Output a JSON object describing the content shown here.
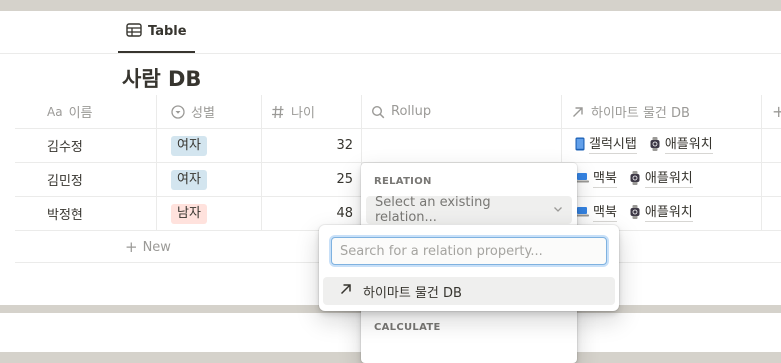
{
  "view_tab": {
    "label": "Table",
    "icon": "table-icon"
  },
  "title": "사람 DB",
  "columns": [
    {
      "label": "이름",
      "prefix": "Aa",
      "icon": "title-text-icon"
    },
    {
      "label": "성별",
      "icon": "select-circle-icon"
    },
    {
      "label": "나이",
      "icon": "hash-icon"
    },
    {
      "label": "Rollup",
      "icon": "search-icon"
    },
    {
      "label": "하이마트 물건 DB",
      "icon": "arrow-up-right-icon"
    },
    {
      "label": "+",
      "icon": "plus-icon"
    }
  ],
  "rows": [
    {
      "name": "김수정",
      "gender": "여자",
      "gender_color": "#d3e5ef",
      "age": "32",
      "relations": [
        {
          "icon": "tablet-icon",
          "label": "갤럭시탭"
        },
        {
          "icon": "watch-icon",
          "label": "애플워치"
        }
      ]
    },
    {
      "name": "김민정",
      "gender": "여자",
      "gender_color": "#d3e5ef",
      "age": "25",
      "relations": [
        {
          "icon": "laptop-icon",
          "label": "맥북"
        },
        {
          "icon": "watch-icon",
          "label": "애플워치"
        }
      ]
    },
    {
      "name": "박정현",
      "gender": "남자",
      "gender_color": "#ffe2dd",
      "age": "48",
      "relations": [
        {
          "icon": "laptop-icon",
          "label": "맥북"
        },
        {
          "icon": "watch-icon",
          "label": "애플워치"
        }
      ]
    }
  ],
  "new_row_label": "New",
  "rollup_panel": {
    "relation_section": "RELATION",
    "relation_select_placeholder": "Select an existing relation...",
    "calculate_section": "CALCULATE"
  },
  "relation_popup": {
    "search_placeholder": "Search for a relation property...",
    "options": [
      {
        "icon": "arrow-up-right-icon",
        "label": "하이마트 물건 DB"
      }
    ]
  },
  "colors": {
    "accent_blue": "#2383e2",
    "tag_blue": "#d3e5ef",
    "tag_red": "#ffe2dd",
    "text": "#37352f",
    "muted": "#9b9a97"
  }
}
